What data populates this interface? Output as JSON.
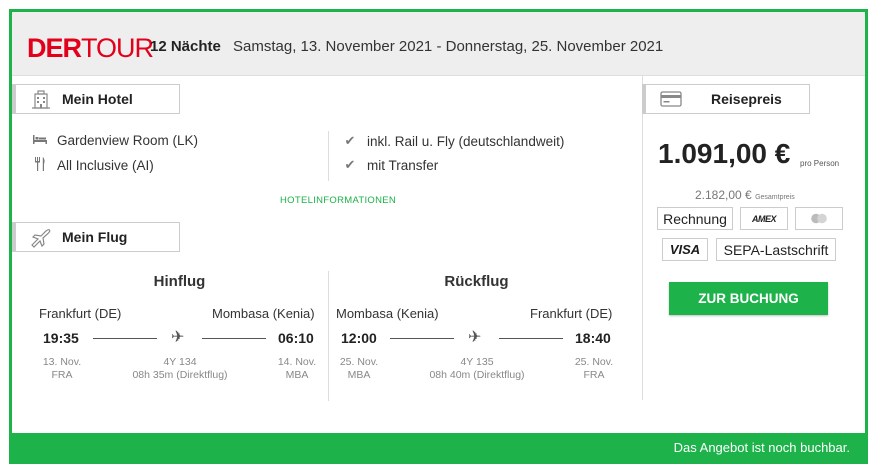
{
  "header": {
    "logo_der": "DER",
    "logo_tour": "TOUR",
    "nights": "12 Nächte",
    "dates": "Samstag, 13. November 2021 - Donnerstag, 25. November 2021"
  },
  "hotel": {
    "heading": "Mein Hotel",
    "room": "Gardenview Room (LK)",
    "board": "All Inclusive (AI)",
    "inclusions": [
      "inkl. Rail u. Fly (deutschlandweit)",
      "mit Transfer"
    ],
    "info_link": "HOTELINFORMATIONEN"
  },
  "flight": {
    "heading": "Mein Flug",
    "outbound": {
      "title": "Hinflug",
      "from_city": "Frankfurt (DE)",
      "to_city": "Mombasa (Kenia)",
      "dep_time": "19:35",
      "arr_time": "06:10",
      "dep_date": "13. Nov.",
      "dep_code": "FRA",
      "arr_date": "14. Nov.",
      "arr_code": "MBA",
      "flight_no": "4Y 134",
      "duration": "08h 35m (Direktflug)"
    },
    "return": {
      "title": "Rückflug",
      "from_city": "Mombasa (Kenia)",
      "to_city": "Frankfurt (DE)",
      "dep_time": "12:00",
      "arr_time": "18:40",
      "dep_date": "25. Nov.",
      "dep_code": "MBA",
      "arr_date": "25. Nov.",
      "arr_code": "FRA",
      "flight_no": "4Y 135",
      "duration": "08h 40m (Direktflug)"
    }
  },
  "price": {
    "heading": "Reisepreis",
    "per_person": "1.091,00 €",
    "per_person_label": "pro Person",
    "total": "2.182,00 €",
    "total_label": "Gesamtpreis",
    "payments": [
      "Rechnung",
      "AMEX",
      "",
      "VISA",
      "SEPA-Lastschrift"
    ],
    "book_button": "ZUR BUCHUNG"
  },
  "footer": {
    "status": "Das Angebot ist noch buchbar."
  },
  "colors": {
    "brand_green": "#1db24a",
    "logo_red": "#e2001a"
  }
}
